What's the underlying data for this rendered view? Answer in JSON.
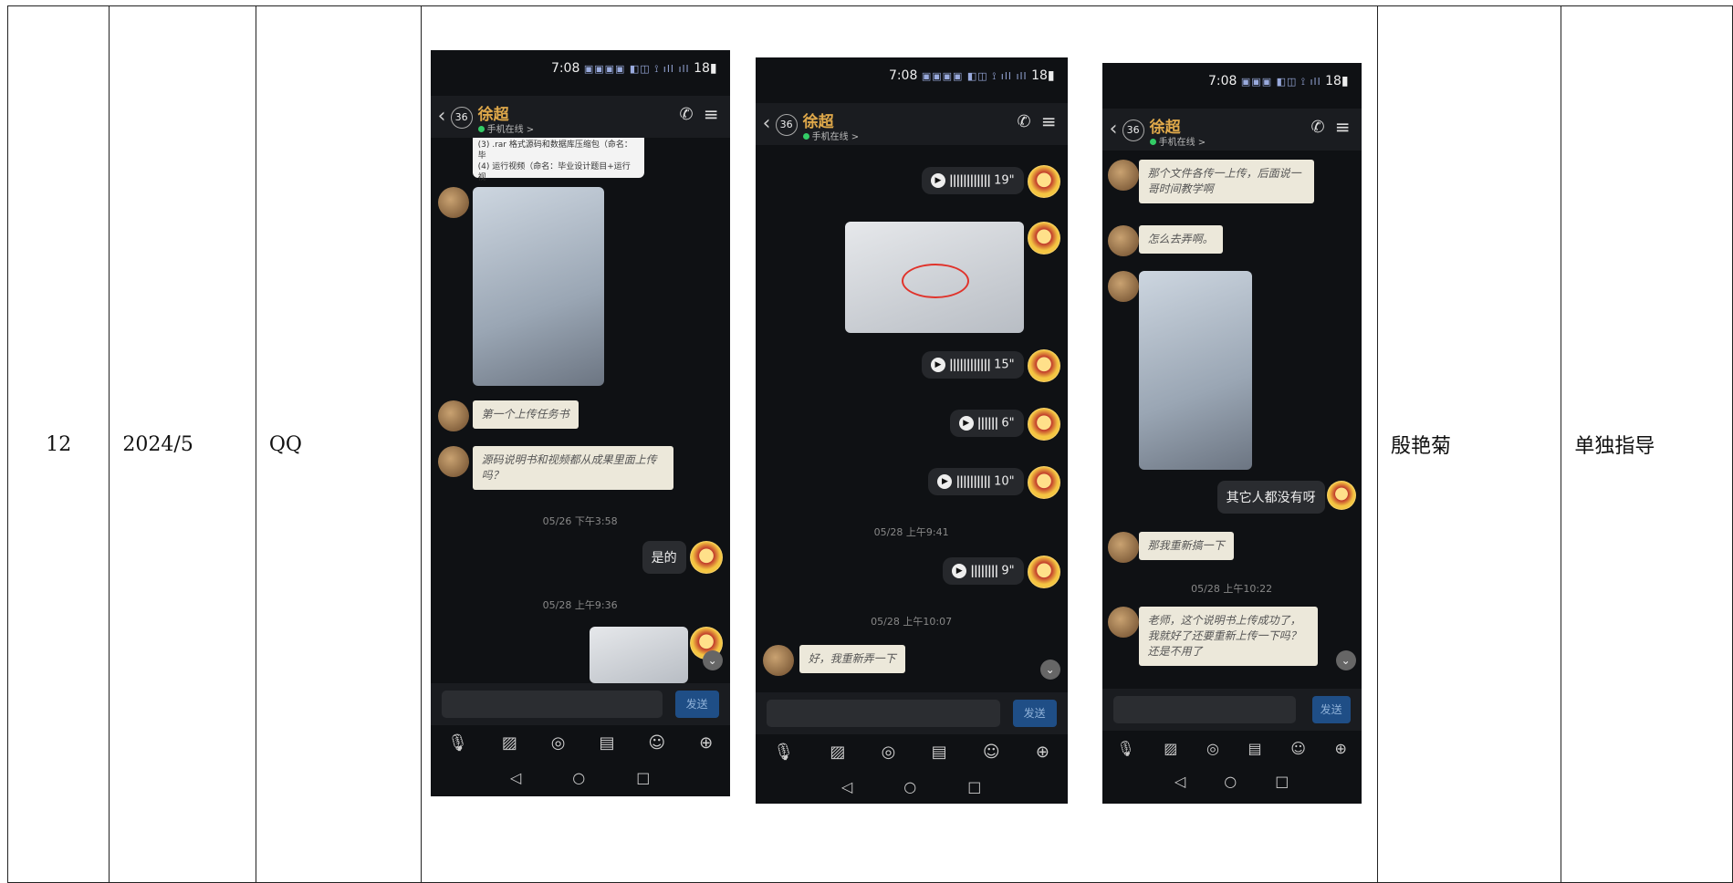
{
  "row": {
    "index": "12",
    "date": "2024/5",
    "platform": "QQ",
    "teacher": "殷艳菊",
    "method": "单独指导"
  },
  "phone": {
    "status_time": "7:08",
    "battery": "18",
    "contact_name": "徐超",
    "unread_badge": "36",
    "online_status": "手机在线 >",
    "send_label": "发送",
    "back_icon": "chevron-left-icon",
    "call_icon": "phone-icon",
    "menu_icon": "menu-icon"
  },
  "screen1": {
    "doc_lines": [
      "(3) .rar 格式源码和数据库压缩包（命名：毕",
      "(4) 运行视频（命名：毕业设计题目+运行视"
    ],
    "msg1": "第一个上传任务书",
    "msg2": "源码说明书和视频都从成果里面上传吗？",
    "time1": "05/26 下午3:58",
    "reply1": "是的",
    "time2": "05/28 上午9:36"
  },
  "screen2": {
    "voice1": "19\"",
    "voice2": "15\"",
    "voice3": "6\"",
    "voice4": "10\"",
    "time1": "05/28 上午9:41",
    "voice5": "9\"",
    "time2": "05/28 上午10:07",
    "msg1": "好，我重新弄一下"
  },
  "screen3": {
    "msg1": "那个文件各传一上传，后面说一哥时间教学啊",
    "msg2": "怎么去弄啊。",
    "reply1": "其它人都没有呀",
    "msg3": "那我重新搞一下",
    "time1": "05/28 上午10:22",
    "msg4": "老师，这个说明书上传成功了，我就好了还要重新上传一下吗？还是不用了"
  }
}
